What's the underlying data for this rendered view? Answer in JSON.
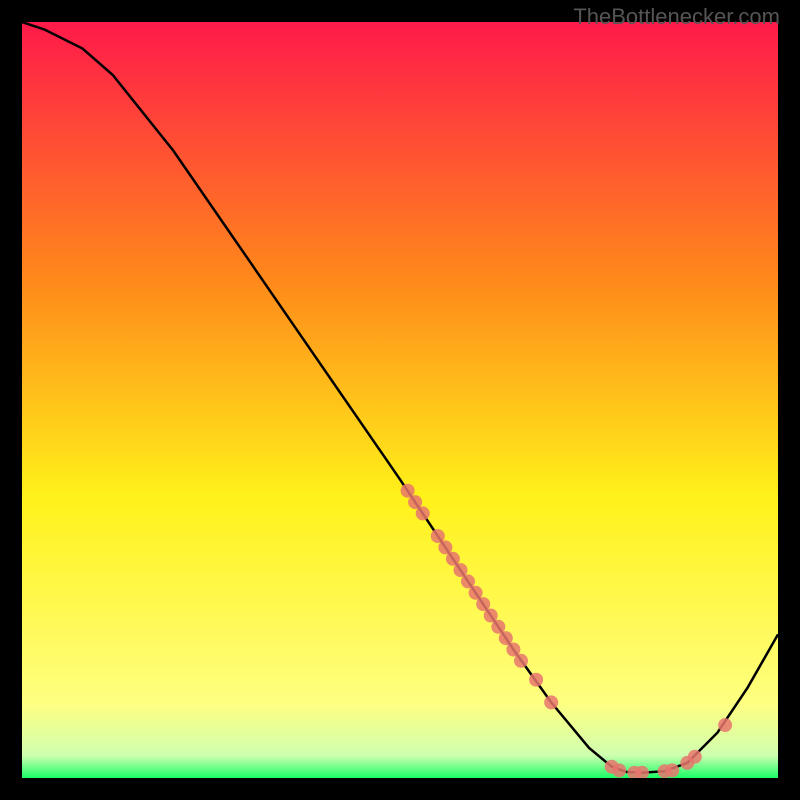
{
  "watermark": "TheBottlenecker.com",
  "chart_data": {
    "type": "line",
    "title": "",
    "xlabel": "",
    "ylabel": "",
    "xlim": [
      0,
      100
    ],
    "ylim": [
      0,
      100
    ],
    "curve": [
      {
        "x": 0,
        "y": 100
      },
      {
        "x": 3,
        "y": 99
      },
      {
        "x": 8,
        "y": 96.5
      },
      {
        "x": 12,
        "y": 93
      },
      {
        "x": 20,
        "y": 83
      },
      {
        "x": 30,
        "y": 68.5
      },
      {
        "x": 40,
        "y": 54
      },
      {
        "x": 50,
        "y": 39.5
      },
      {
        "x": 55,
        "y": 32
      },
      {
        "x": 60,
        "y": 24.5
      },
      {
        "x": 65,
        "y": 17
      },
      {
        "x": 70,
        "y": 10
      },
      {
        "x": 75,
        "y": 4
      },
      {
        "x": 78,
        "y": 1.5
      },
      {
        "x": 80,
        "y": 0.8
      },
      {
        "x": 82,
        "y": 0.7
      },
      {
        "x": 85,
        "y": 0.9
      },
      {
        "x": 88,
        "y": 2
      },
      {
        "x": 92,
        "y": 6
      },
      {
        "x": 96,
        "y": 12
      },
      {
        "x": 100,
        "y": 19
      }
    ],
    "scatter_points": [
      {
        "x": 51,
        "y": 38
      },
      {
        "x": 52,
        "y": 36.5
      },
      {
        "x": 53,
        "y": 35
      },
      {
        "x": 55,
        "y": 32
      },
      {
        "x": 56,
        "y": 30.5
      },
      {
        "x": 57,
        "y": 29
      },
      {
        "x": 58,
        "y": 27.5
      },
      {
        "x": 59,
        "y": 26
      },
      {
        "x": 60,
        "y": 24.5
      },
      {
        "x": 61,
        "y": 23
      },
      {
        "x": 62,
        "y": 21.5
      },
      {
        "x": 63,
        "y": 20
      },
      {
        "x": 64,
        "y": 18.5
      },
      {
        "x": 65,
        "y": 17
      },
      {
        "x": 66,
        "y": 15.5
      },
      {
        "x": 68,
        "y": 13
      },
      {
        "x": 70,
        "y": 10
      },
      {
        "x": 78,
        "y": 1.5
      },
      {
        "x": 79,
        "y": 1
      },
      {
        "x": 81,
        "y": 0.7
      },
      {
        "x": 82,
        "y": 0.7
      },
      {
        "x": 85,
        "y": 0.9
      },
      {
        "x": 86,
        "y": 1
      },
      {
        "x": 88,
        "y": 2
      },
      {
        "x": 89,
        "y": 2.8
      },
      {
        "x": 93,
        "y": 7
      }
    ],
    "gradient_top": "#ff1a4a",
    "gradient_mid1": "#ff8c1a",
    "gradient_mid2": "#fff21a",
    "gradient_mid3": "#ffff80",
    "gradient_bottom": "#1aff66",
    "point_color": "#e8766d",
    "curve_color": "#000000"
  }
}
